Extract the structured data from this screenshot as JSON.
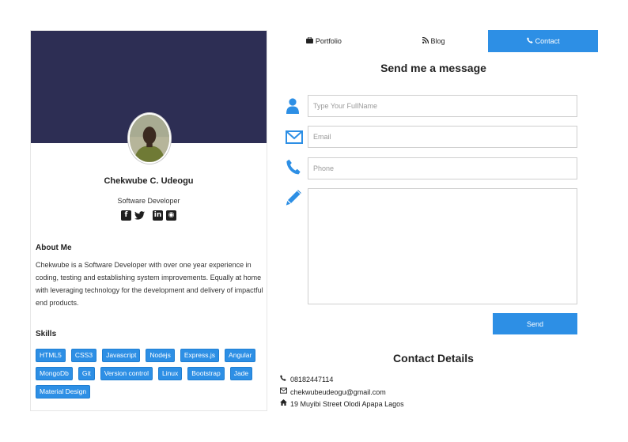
{
  "profile": {
    "name": "Chekwube C. Udeogu",
    "role": "Software Developer",
    "social": [
      {
        "icon": "facebook-icon",
        "glyph": "f"
      },
      {
        "icon": "twitter-icon",
        "glyph": "🐦"
      },
      {
        "icon": "linkedin-icon",
        "glyph": "in"
      },
      {
        "icon": "github-icon",
        "glyph": "◉"
      }
    ]
  },
  "about": {
    "title": "About Me",
    "text": "Chekwube is a Software Developer with over one year experience in coding, testing and establishing system improvements. Equally at home with leveraging technology for the development and delivery of impactful end products."
  },
  "skills": {
    "title": "Skills",
    "items": [
      "HTML5",
      "CSS3",
      "Javascript",
      "Nodejs",
      "Express.js",
      "Angular",
      "MongoDb",
      "Git",
      "Version control",
      "Linux",
      "Bootstrap",
      "Jade",
      "Material Design"
    ]
  },
  "tabs": [
    {
      "label": "Portfolio",
      "icon": "briefcase-icon",
      "glyph": "💼"
    },
    {
      "label": "Blog",
      "icon": "rss-icon",
      "glyph": "⟟"
    },
    {
      "label": "Contact",
      "icon": "phone-icon",
      "glyph": "✆"
    }
  ],
  "form": {
    "title": "Send me a message",
    "fullname_placeholder": "Type Your FullName",
    "email_placeholder": "Email",
    "phone_placeholder": "Phone",
    "message_value": "",
    "send_label": "Send"
  },
  "contact": {
    "title": "Contact Details",
    "phone": "08182447114",
    "email": "chekwubeudeogu@gmail.com",
    "address": "19 Muyibi Street Olodi Apapa Lagos"
  },
  "colors": {
    "banner": "#2d2e54",
    "accent": "#2d8fe5"
  }
}
